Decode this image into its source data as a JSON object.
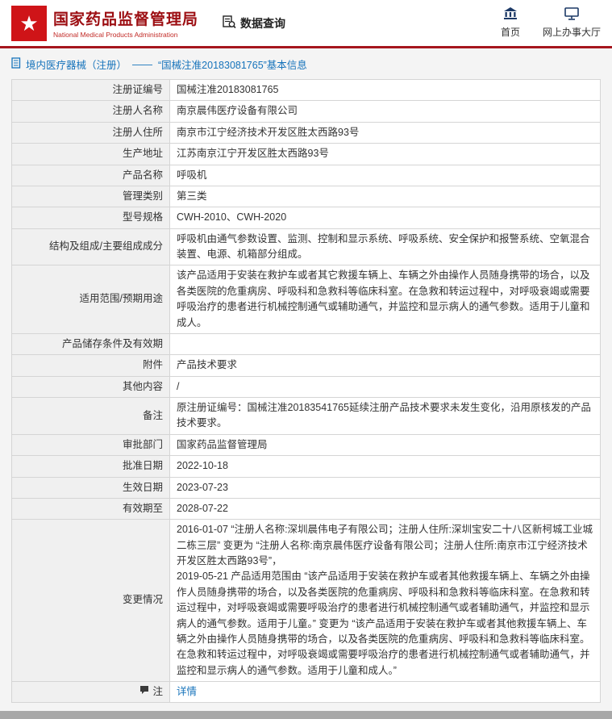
{
  "header": {
    "agency_name_cn": "国家药品监督管理局",
    "agency_name_en": "National Medical Products Administration",
    "nav_data_query": "数据查询",
    "nav_home": "首页",
    "nav_online_hall": "网上办事大厅"
  },
  "breadcrumb": {
    "section": "境内医疗器械（注册）",
    "separator": "——",
    "title": "“国械注准20183081765”基本信息"
  },
  "table": {
    "rows": [
      {
        "label": "注册证编号",
        "value": "国械注准20183081765"
      },
      {
        "label": "注册人名称",
        "value": "南京晨伟医疗设备有限公司"
      },
      {
        "label": "注册人住所",
        "value": "南京市江宁经济技术开发区胜太西路93号"
      },
      {
        "label": "生产地址",
        "value": "江苏南京江宁开发区胜太西路93号"
      },
      {
        "label": "产品名称",
        "value": "呼吸机"
      },
      {
        "label": "管理类别",
        "value": "第三类"
      },
      {
        "label": "型号规格",
        "value": "CWH-2010、CWH-2020"
      },
      {
        "label": "结构及组成/主要组成成分",
        "value": "呼吸机由通气参数设置、监测、控制和显示系统、呼吸系统、安全保护和报警系统、空氧混合装置、电源、机箱部分组成。"
      },
      {
        "label": "适用范围/预期用途",
        "value": "该产品适用于安装在救护车或者其它救援车辆上、车辆之外由操作人员随身携带的场合，以及各类医院的危重病房、呼吸科和急救科等临床科室。在急救和转运过程中，对呼吸衰竭或需要呼吸治疗的患者进行机械控制通气或辅助通气，并监控和显示病人的通气参数。适用于儿童和成人。"
      },
      {
        "label": "产品储存条件及有效期",
        "value": ""
      },
      {
        "label": "附件",
        "value": "产品技术要求"
      },
      {
        "label": "其他内容",
        "value": "/"
      },
      {
        "label": "备注",
        "value": "原注册证编号：国械注准20183541765延续注册产品技术要求未发生变化，沿用原核发的产品技术要求。"
      },
      {
        "label": "审批部门",
        "value": "国家药品监督管理局"
      },
      {
        "label": "批准日期",
        "value": "2022-10-18"
      },
      {
        "label": "生效日期",
        "value": "2023-07-23"
      },
      {
        "label": "有效期至",
        "value": "2028-07-22"
      },
      {
        "label": "变更情况",
        "value": "2016-01-07 “注册人名称:深圳晨伟电子有限公司；注册人住所:深圳宝安二十八区新柯城工业城二栋三层” 变更为 “注册人名称:南京晨伟医疗设备有限公司；注册人住所:南京市江宁经济技术开发区胜太西路93号”，\n2019-05-21 产品适用范围由 “该产品适用于安装在救护车或者其他救援车辆上、车辆之外由操作人员随身携带的场合，以及各类医院的危重病房、呼吸科和急救科等临床科室。在急救和转运过程中，对呼吸衰竭或需要呼吸治疗的患者进行机械控制通气或者辅助通气，并监控和显示病人的通气参数。适用于儿童。” 变更为 “该产品适用于安装在救护车或者其他救援车辆上、车辆之外由操作人员随身携带的场合，以及各类医院的危重病房、呼吸科和急救科等临床科室。在急救和转运过程中，对呼吸衰竭或需要呼吸治疗的患者进行机械控制通气或者辅助通气，并监控和显示病人的通气参数。适用于儿童和成人。”"
      }
    ]
  },
  "note_row": {
    "label": "注",
    "link_label": "详情"
  },
  "colors": {
    "brand_red": "#9c0e12",
    "line_red": "#a6161d",
    "link_blue": "#1673bb",
    "label_bg": "#f0f0f0"
  }
}
